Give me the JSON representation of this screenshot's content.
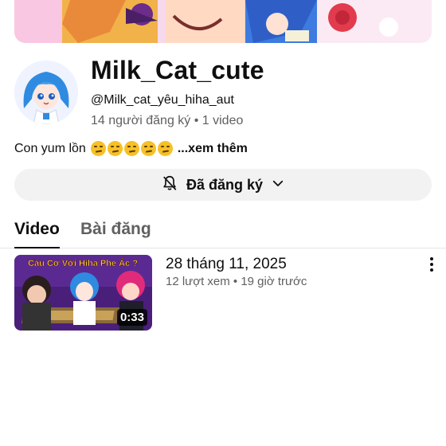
{
  "channel": {
    "name": "Milk_Cat_cute",
    "handle": "@Milk_cat_yêu_hiha_aut",
    "stats": "14 người đăng ký • 1 video",
    "description": "Con yum lồn",
    "more_label": "...xem thêm"
  },
  "subscribe": {
    "label": "Đã đăng ký",
    "icon": "bell-off-icon"
  },
  "tabs": [
    {
      "label": "Video",
      "active": true
    },
    {
      "label": "Bài đăng",
      "active": false
    }
  ],
  "videos": [
    {
      "title": "28 tháng 11, 2025",
      "meta": "12 lượt xem • 19 giờ trước",
      "duration": "0:33",
      "thumbnail_text": "Cầu Cơ Với Hiha Phe Ác ?"
    }
  ],
  "colors": {
    "text": "#0f0f0f",
    "secondary": "#606060",
    "button_bg": "#f2f2f2",
    "divider": "#e5e5e5"
  }
}
